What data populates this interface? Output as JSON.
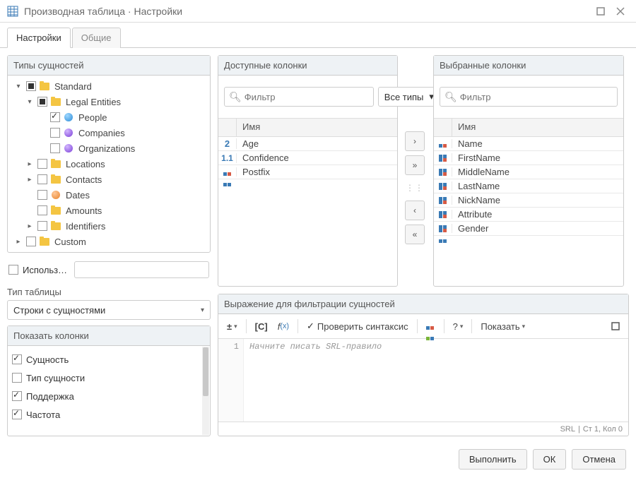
{
  "window": {
    "title": "Производная таблица · Настройки"
  },
  "tabs": {
    "settings": "Настройки",
    "general": "Общие"
  },
  "panels": {
    "entity_types": "Типы сущностей",
    "available": "Доступные колонки",
    "selected": "Выбранные колонки",
    "show_columns": "Показать колонки",
    "expression": "Выражение для фильтрации сущностей"
  },
  "tree": {
    "standard": "Standard",
    "legal_entities": "Legal Entities",
    "people": "People",
    "companies": "Companies",
    "organizations": "Organizations",
    "locations": "Locations",
    "contacts": "Contacts",
    "dates": "Dates",
    "amounts": "Amounts",
    "identifiers": "Identifiers",
    "custom": "Custom"
  },
  "use_template": {
    "label": "Использовать ш…"
  },
  "table_type": {
    "label": "Тип таблицы",
    "value": "Строки с сущностями"
  },
  "show_columns": {
    "entity": "Сущность",
    "entity_type": "Тип сущности",
    "support": "Поддержка",
    "frequency": "Частота"
  },
  "filter": {
    "placeholder": "Фильтр",
    "alltypes": "Все типы"
  },
  "col_header": "Имя",
  "available_cols": {
    "age": "Age",
    "confidence": "Confidence",
    "postfix": "Postfix"
  },
  "selected_cols": {
    "name": "Name",
    "firstname": "FirstName",
    "middlename": "MiddleName",
    "lastname": "LastName",
    "nickname": "NickName",
    "attribute": "Attribute",
    "gender": "Gender"
  },
  "expr": {
    "check_syntax": "Проверить синтаксис",
    "show": "Показать",
    "placeholder": "Начните писать SRL-правило",
    "line1": "1",
    "status_lang": "SRL",
    "status_pos": "Ст 1, Кол 0"
  },
  "buttons": {
    "execute": "Выполнить",
    "ok": "ОК",
    "cancel": "Отмена"
  }
}
